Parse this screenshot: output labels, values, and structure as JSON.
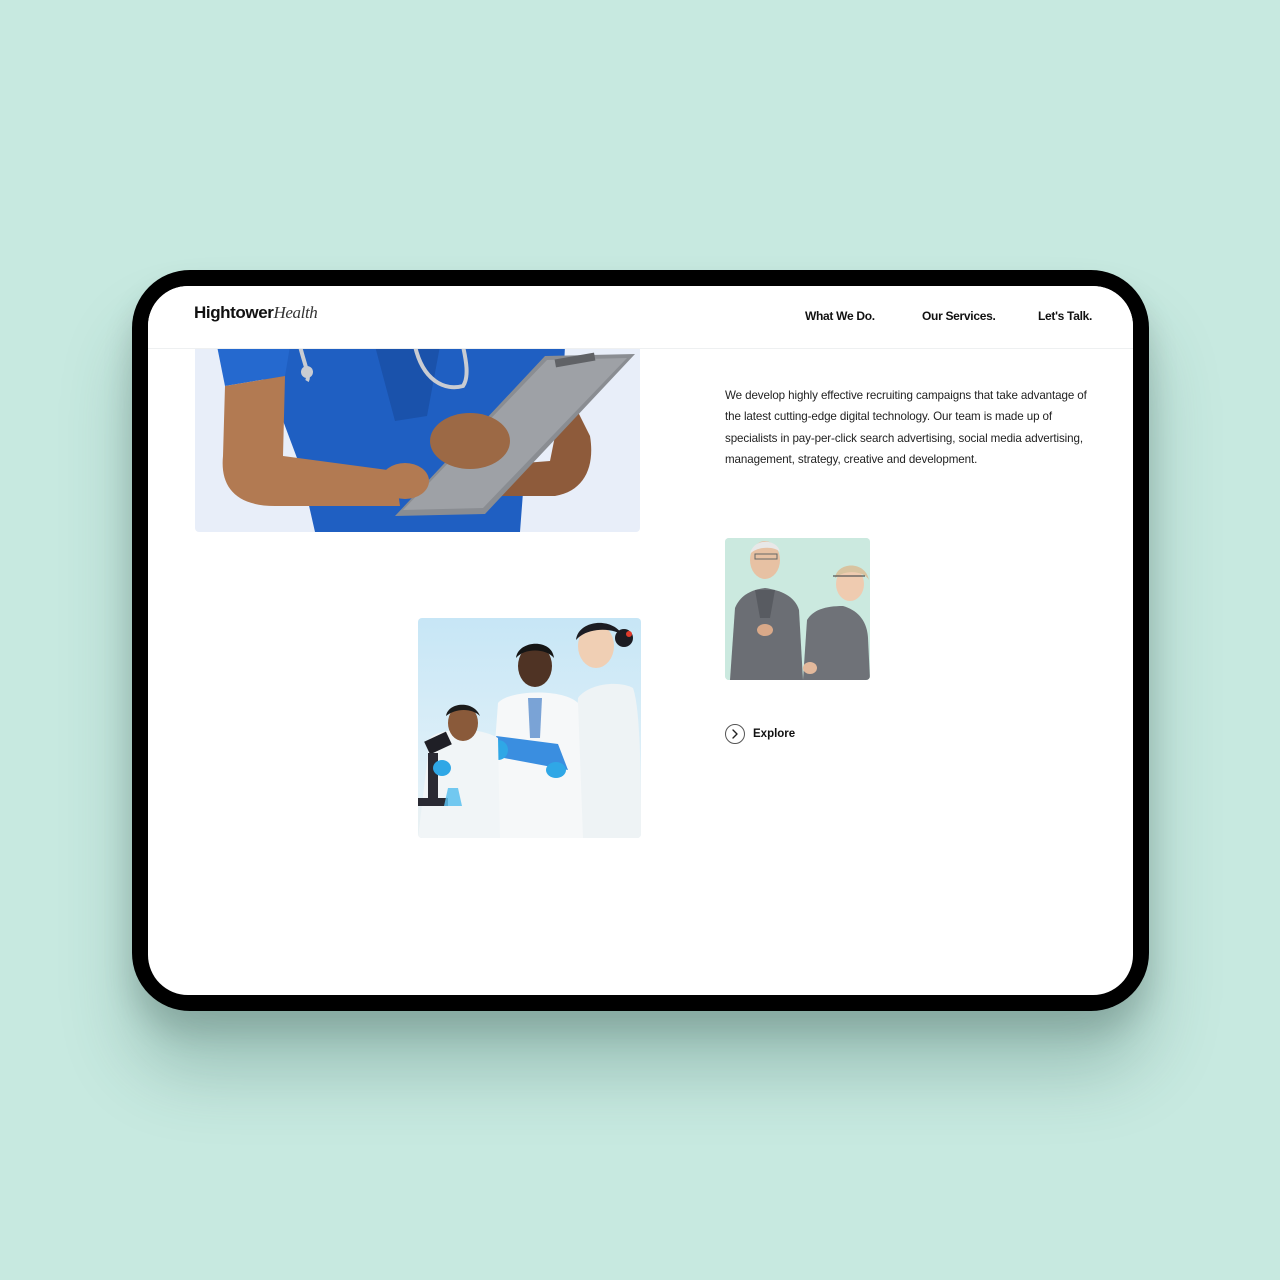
{
  "brand": {
    "logo_bold": "Hightower",
    "logo_light": "Health"
  },
  "nav": {
    "items": [
      {
        "label": "What We Do."
      },
      {
        "label": "Our Services."
      },
      {
        "label": "Let's Talk."
      }
    ]
  },
  "main": {
    "paragraph": "We develop highly effective recruiting campaigns that take advantage of the latest cutting-edge digital technology. Our team is made up of specialists in pay-per-click search advertising, social media advertising, management, strategy, creative and development.",
    "explore_label": "Explore",
    "explore_icon": "chevron-right-icon"
  },
  "colors": {
    "background": "#c7e9e0",
    "device_frame": "#000000",
    "screen": "#ffffff",
    "text": "#111111"
  }
}
